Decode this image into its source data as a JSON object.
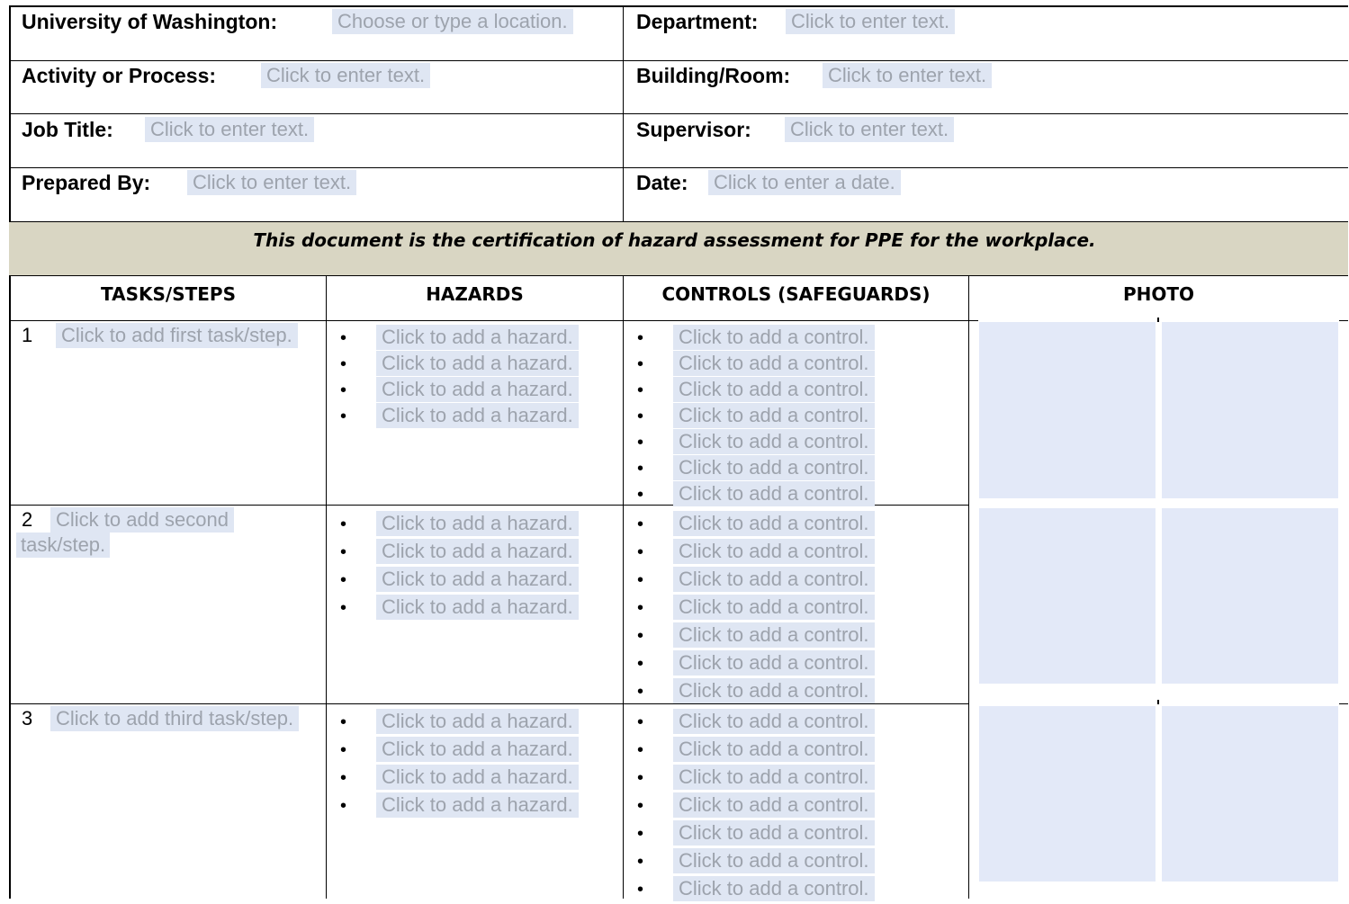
{
  "header": {
    "university_label": "University of Washington:",
    "university_placeholder": "Choose or type a location.",
    "department_label": "Department:",
    "department_placeholder": "Click to enter text.",
    "activity_label": "Activity or Process:",
    "activity_placeholder": "Click to enter text.",
    "building_label": "Building/Room:",
    "building_placeholder": "Click to enter text.",
    "jobtitle_label": "Job Title:",
    "jobtitle_placeholder": "Click to enter text.",
    "supervisor_label": "Supervisor:",
    "supervisor_placeholder": "Click to enter text.",
    "preparedby_label": "Prepared By:",
    "preparedby_placeholder": "Click to enter text.",
    "date_label": "Date:",
    "date_placeholder": "Click to enter a date."
  },
  "banner": "This document is the certification of hazard assessment for PPE for the workplace.",
  "columns": {
    "tasks": "TASKS/STEPS",
    "hazards": "HAZARDS",
    "controls": "CONTROLS (SAFEGUARDS)",
    "photo": "PHOTO"
  },
  "rows": [
    {
      "number": "1",
      "task_placeholder": "Click to add first task/step.",
      "hazards": [
        "Click to add a hazard.",
        "Click to add a hazard.",
        "Click to add a hazard.",
        "Click to add a hazard."
      ],
      "controls": [
        "Click to add a control.",
        "Click to add a control.",
        "Click to add a control.",
        "Click to add a control.",
        "Click to add a control.",
        "Click to add a control.",
        "Click to add a control."
      ]
    },
    {
      "number": "2",
      "task_placeholder_line1": "Click to add second",
      "task_placeholder_line2": "task/step.",
      "hazards": [
        "Click to add a hazard.",
        "Click to add a hazard.",
        "Click to add a hazard.",
        "Click to add a hazard."
      ],
      "controls": [
        "Click to add a control.",
        "Click to add a control.",
        "Click to add a control.",
        "Click to add a control.",
        "Click to add a control.",
        "Click to add a control.",
        "Click to add a control."
      ]
    },
    {
      "number": "3",
      "task_placeholder": "Click to add third task/step.",
      "hazards": [
        "Click to add a hazard.",
        "Click to add a hazard.",
        "Click to add a hazard.",
        "Click to add a hazard."
      ],
      "controls": [
        "Click to add a control.",
        "Click to add a control.",
        "Click to add a control.",
        "Click to add a control.",
        "Click to add a control.",
        "Click to add a control.",
        "Click to add a control."
      ]
    }
  ],
  "bullet_glyph": "•"
}
